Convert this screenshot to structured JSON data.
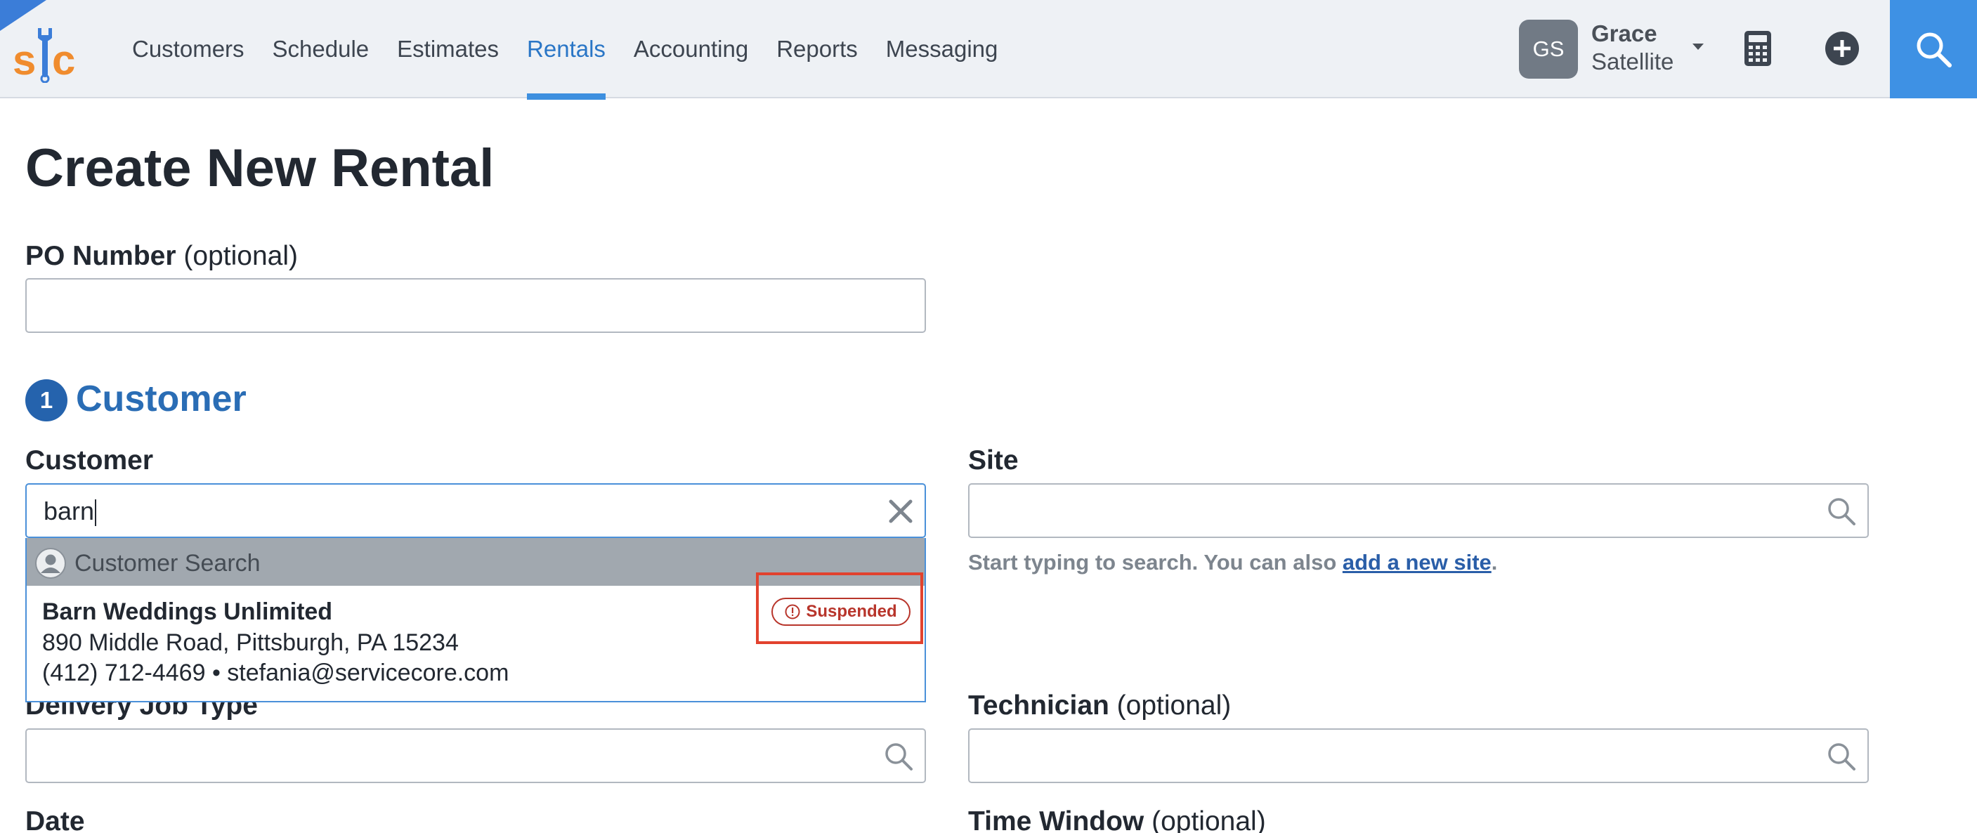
{
  "nav": {
    "links": [
      "Customers",
      "Schedule",
      "Estimates",
      "Rentals",
      "Accounting",
      "Reports",
      "Messaging"
    ],
    "active_index": 3,
    "user": {
      "initials": "GS",
      "first_name": "Grace",
      "last_name": "Satellite"
    },
    "icons": {
      "logo": "sc-wrench-logo",
      "calculator": "calculator-icon",
      "add": "plus-circle-icon",
      "search": "search-icon"
    }
  },
  "page": {
    "title": "Create New Rental"
  },
  "po_number": {
    "label": "PO Number",
    "optional": "(optional)",
    "value": ""
  },
  "section_customer": {
    "step": "1",
    "title": "Customer"
  },
  "customer": {
    "label": "Customer",
    "value": "barn",
    "dropdown": {
      "header": "Customer Search",
      "results": [
        {
          "name": "Barn Weddings Unlimited",
          "address": "890 Middle Road, Pittsburgh, PA 15234",
          "contact": "(412) 712-4469 • stefania@servicecore.com",
          "badge": "Suspended"
        }
      ]
    }
  },
  "site": {
    "label": "Site",
    "value": "",
    "helper_before": "Start typing to search. You can also ",
    "helper_link": "add a new site",
    "helper_after": "."
  },
  "delivery_job_type": {
    "label": "Delivery Job Type",
    "value": ""
  },
  "technician": {
    "label": "Technician",
    "optional": "(optional)",
    "value": ""
  },
  "date": {
    "label": "Date"
  },
  "time_window": {
    "label": "Time Window",
    "optional": "(optional)"
  },
  "colors": {
    "accent": "#3e91e4",
    "active_tab": "#2a76c6",
    "section_title": "#2a6db5",
    "badge_red": "#b8352b",
    "highlight_red": "#e2422e"
  }
}
